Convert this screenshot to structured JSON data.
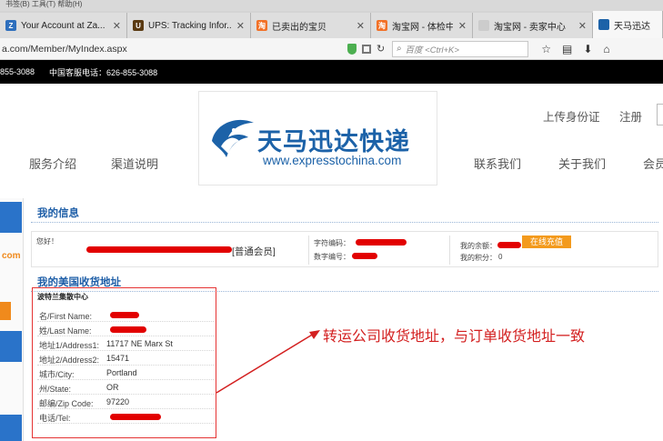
{
  "browser": {
    "menu_text": "书签(B)   工具(T)   帮助(H)",
    "tabs": [
      {
        "title": "Your Account at Za...",
        "favicon": "Z",
        "favicon_color": "#2e6fbd"
      },
      {
        "title": "UPS: Tracking Infor...",
        "favicon": "U",
        "favicon_color": "#5a3a12"
      },
      {
        "title": "已卖出的宝贝",
        "favicon": "淘",
        "favicon_color": "#f27127"
      },
      {
        "title": "淘宝网 - 体检中心",
        "favicon": "淘",
        "favicon_color": "#f27127"
      },
      {
        "title": "淘宝网 - 卖家中心",
        "favicon": "",
        "favicon_color": "#cccccc"
      },
      {
        "title": "天马迅达",
        "favicon": "",
        "favicon_color": "#1c62a8"
      }
    ],
    "url": "a.com/Member/MyIndex.aspx",
    "search_placeholder": "百度 <Ctrl+K>"
  },
  "site": {
    "phone_left": "855-3088",
    "phone_cn": "中国客服电话：626-855-3088",
    "logo_text": "天马迅达快递",
    "logo_url": "www.expresstochina.com",
    "top_links": [
      "上传身份证",
      "注册"
    ],
    "nav": [
      "服务介绍",
      "渠道说明",
      "联系我们",
      "关于我们",
      "会员"
    ],
    "left_com": "com"
  },
  "info": {
    "title": "我的信息",
    "greeting": "您好！",
    "member_level": "[普通会员]",
    "char_code_label": "字符编码：",
    "num_code_label": "数字编号：",
    "balance_label": "我的余额：",
    "points_label": "我的积分：",
    "points": "0",
    "recharge_label": "在线充值"
  },
  "address": {
    "title": "我的美国收货地址",
    "center": "波特兰集散中心",
    "rows": [
      {
        "label": "名/First Name:",
        "value": ""
      },
      {
        "label": "姓/Last Name:",
        "value": ""
      },
      {
        "label": "地址1/Address1:",
        "value": "11717 NE Marx St"
      },
      {
        "label": "地址2/Address2:",
        "value": "15471"
      },
      {
        "label": "城市/City:",
        "value": "Portland"
      },
      {
        "label": "州/State:",
        "value": "OR"
      },
      {
        "label": "邮编/Zip Code:",
        "value": "97220"
      },
      {
        "label": "电话/Tel:",
        "value": ""
      }
    ]
  },
  "annotation": "转运公司收货地址，与订单收货地址一致",
  "colors": {
    "brand_blue": "#1c62a8",
    "accent_orange": "#f39a1d",
    "annotation_red": "#d32020",
    "redaction_red": "#e20000"
  }
}
